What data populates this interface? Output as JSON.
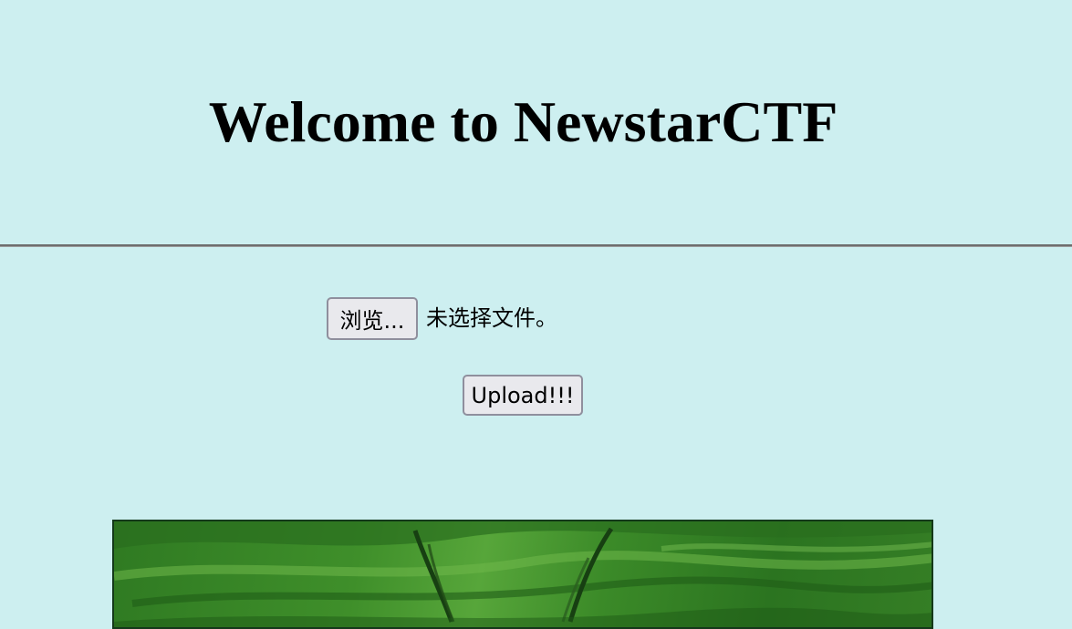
{
  "page": {
    "title": "Welcome to NewstarCTF"
  },
  "upload_form": {
    "browse_label": "浏览...",
    "file_status": "未选择文件。",
    "submit_label": "Upload!!!"
  },
  "colors": {
    "background": "#cdeff0",
    "divider": "#6e6e6e",
    "button_bg": "#e9e9ed",
    "button_border": "#8f8f9d",
    "image_green": "#3f8f2a"
  }
}
